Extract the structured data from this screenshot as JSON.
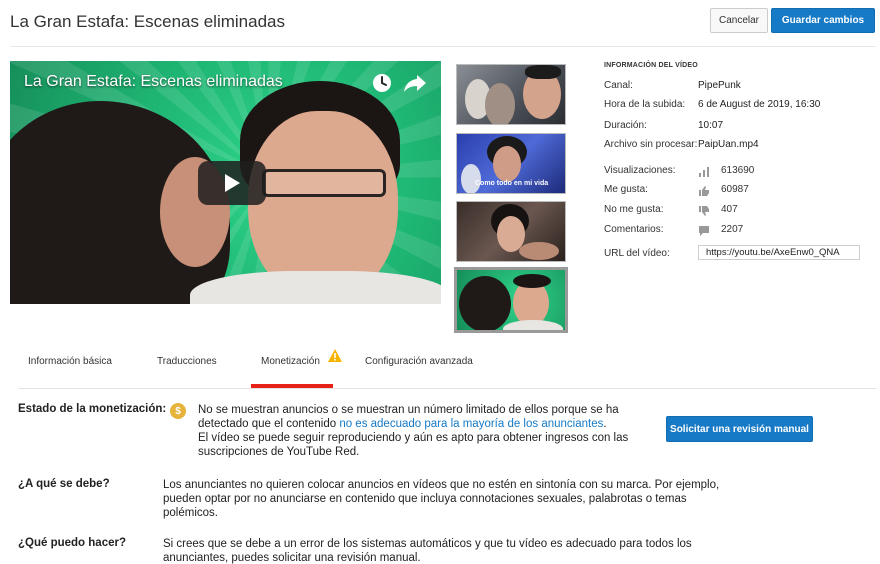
{
  "header": {
    "title": "La Gran Estafa: Escenas eliminadas",
    "cancel_label": "Cancelar",
    "save_label": "Guardar cambios"
  },
  "player": {
    "title": "La Gran Estafa: Escenas eliminadas",
    "icons": [
      "clock-icon",
      "share-icon",
      "play-icon"
    ]
  },
  "thumbnails": {
    "caption_2": "Como todo en mi vida"
  },
  "info": {
    "heading": "INFORMACIÓN DEL VÍDEO",
    "channel_label": "Canal:",
    "channel_value": "PipePunk",
    "upload_label": "Hora de la subida:",
    "upload_value": "6 de August de 2019, 16:30",
    "duration_label": "Duración:",
    "duration_value": "10:07",
    "raw_label": "Archivo sin procesar:",
    "raw_value": "PaipUan.mp4",
    "views_label": "Visualizaciones:",
    "views_value": "613690",
    "likes_label": "Me gusta:",
    "likes_value": "60987",
    "dislikes_label": "No me gusta:",
    "dislikes_value": "407",
    "comments_label": "Comentarios:",
    "comments_value": "2207",
    "url_label": "URL del vídeo:",
    "url_value": "https://youtu.be/AxeEnw0_QNA"
  },
  "tabs": {
    "basic": "Información básica",
    "translations": "Traducciones",
    "monetization": "Monetización",
    "advanced": "Configuración avanzada"
  },
  "monetization": {
    "status_label": "Estado de la monetización:",
    "text_part1": "No se muestran anuncios o se muestran un número limitado de ellos porque se ha detectado que el contenido ",
    "text_link": "no es adecuado para la mayoría de los anunciantes",
    "text_part2": ".",
    "text_line2": "El vídeo se puede seguir reproduciendo y aún es apto para obtener ingresos con las suscripciones de YouTube Red.",
    "review_label": "Solicitar una revisión manual"
  },
  "why": {
    "label": "¿A qué se debe?",
    "text": "Los anunciantes no quieren colocar anuncios en vídeos que no estén en sintonía con su marca. Por ejemplo, pueden optar por no anunciarse en contenido que incluya connotaciones sexuales, palabrotas o temas polémicos."
  },
  "what": {
    "label": "¿Qué puedo hacer?",
    "text": "Si crees que se debe a un error de los sistemas automáticos y que tu vídeo es adecuado para todos los anunciantes, puedes solicitar una revisión manual."
  },
  "colors": {
    "accent": "#167ac6",
    "tab_active": "#e62117",
    "warning": "#f4b400"
  }
}
